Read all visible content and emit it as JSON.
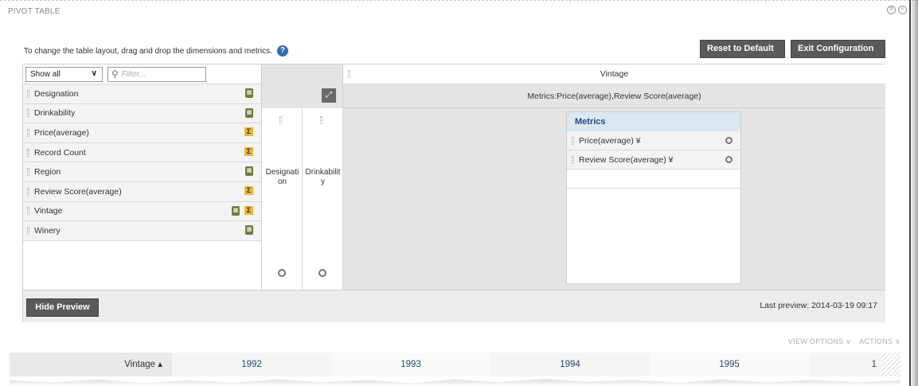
{
  "panel": {
    "title": "PIVOT TABLE"
  },
  "instructions": "To change the table layout, drag and drop the dimensions and metrics.",
  "buttons": {
    "reset": "Reset to Default",
    "exit": "Exit Configuration",
    "hide_preview": "Hide Preview"
  },
  "filter": {
    "show_all": "Show all",
    "placeholder": "Filter..."
  },
  "fields": [
    {
      "label": "Designation",
      "type": "dimension"
    },
    {
      "label": "Drinkability",
      "type": "dimension"
    },
    {
      "label": "Price(average)",
      "type": "metric"
    },
    {
      "label": "Record Count",
      "type": "metric"
    },
    {
      "label": "Region",
      "type": "dimension"
    },
    {
      "label": "Review Score(average)",
      "type": "metric"
    },
    {
      "label": "Vintage",
      "type": "both"
    },
    {
      "label": "Winery",
      "type": "dimension"
    }
  ],
  "pivot": {
    "column_dimension": "Vintage",
    "metrics_header": "Metrics:Price(average),Review Score(average)",
    "row_dimensions": [
      "Designati on",
      "Drinkabilit y"
    ],
    "metrics_card_title": "Metrics",
    "metrics": [
      "Price(average) ¥",
      "Review Score(average) ¥"
    ]
  },
  "last_preview": "Last preview: 2014-03-19 09:17",
  "view_options": "VIEW OPTIONS ∨",
  "actions": "ACTIONS ∨",
  "table": {
    "corner": "Vintage ▴",
    "columns": [
      "1992",
      "1993",
      "1994",
      "1995",
      "1"
    ]
  },
  "colors": {
    "button_dark": "#5a5a5a",
    "metrics_title": "#1e4a78",
    "help_icon": "#2f6db5"
  }
}
